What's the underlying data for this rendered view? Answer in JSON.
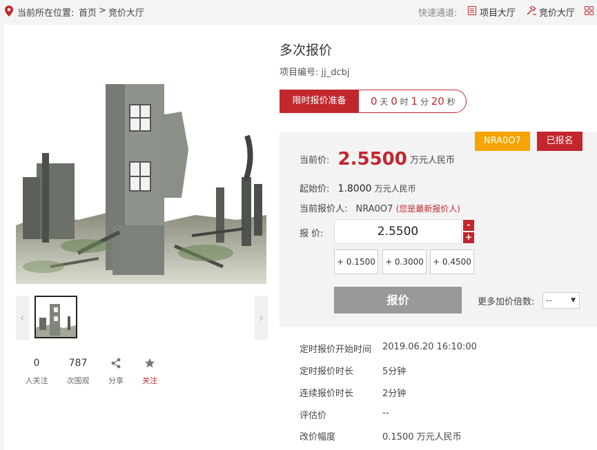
{
  "breadcrumb": {
    "prefix": "当前所在位置:",
    "home": "首页",
    "separator": ">",
    "current": "竞价大厅"
  },
  "quick_nav": {
    "label": "快速通道:",
    "items": [
      {
        "label": "项目大厅",
        "icon": "list-icon"
      },
      {
        "label": "竞价大厅",
        "icon": "gavel-icon"
      }
    ],
    "more_icon": "grid-icon"
  },
  "colors": {
    "accent": "#c1272d",
    "orange": "#f5a400",
    "gray_button": "#999999"
  },
  "gallery": {
    "prev": "‹",
    "next": "›"
  },
  "stats": [
    {
      "value": "0",
      "label": "人关注"
    },
    {
      "value": "787",
      "label": "次围观"
    },
    {
      "icon": "share-icon",
      "label": "分享"
    },
    {
      "icon": "star-icon",
      "label": "关注"
    }
  ],
  "item": {
    "title": "多次报价",
    "project_no_label": "项目编号:",
    "project_no": "jj_dcbj"
  },
  "timer": {
    "status": "限时报价准备",
    "days": "0",
    "days_unit": "天",
    "hours": "0",
    "hours_unit": "时",
    "minutes": "1",
    "minutes_unit": "分",
    "seconds": "20",
    "seconds_unit": "秒"
  },
  "bidding": {
    "user_tag": "NRA0O7",
    "registered_tag": "已报名",
    "current_price_label": "当前价:",
    "current_price": "2.5500",
    "price_unit": "万元人民币",
    "start_price_label": "起始价:",
    "start_price": "1.8000",
    "current_bidder_label": "当前报价人:",
    "current_bidder": "NRA0O7",
    "latest_note": "(您是最新报价人)",
    "bid_label": "报 价:",
    "bid_value": "2.5500",
    "minus": "-",
    "plus": "+",
    "increments": [
      "+ 0.1500",
      "+ 0.3000",
      "+ 0.4500"
    ],
    "submit": "报价",
    "multiplier_label": "更多加价倍数:",
    "multiplier_value": "--"
  },
  "details": [
    {
      "label": "定时报价开始时间",
      "value": "2019.06.20 16:10:00"
    },
    {
      "label": "定时报价时长",
      "value": "5分钟"
    },
    {
      "label": "连续报价时长",
      "value": "2分钟"
    },
    {
      "label": "评估价",
      "value": "--"
    },
    {
      "label": "改价幅度",
      "value": "0.1500 万元人民币"
    }
  ]
}
